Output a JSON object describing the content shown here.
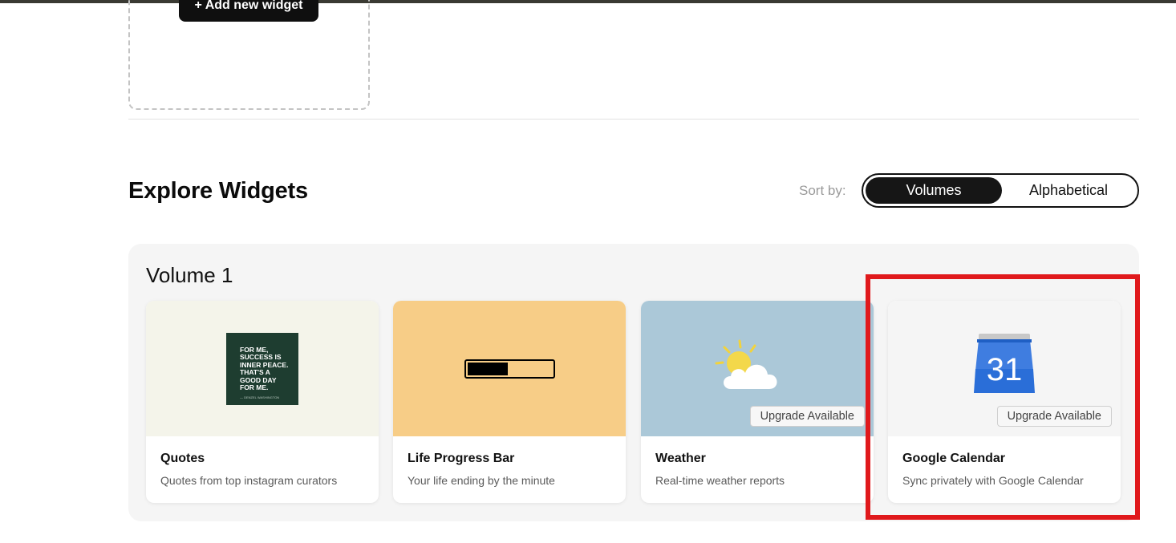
{
  "add_widget": {
    "label": "+ Add new widget"
  },
  "explore": {
    "title": "Explore Widgets",
    "sort_label": "Sort by:",
    "sort_options": {
      "active": "Volumes",
      "inactive": "Alphabetical"
    }
  },
  "volume": {
    "title": "Volume 1",
    "cards": [
      {
        "name": "Quotes",
        "description": "Quotes from top instagram curators",
        "thumb_bg": "#f4f4ea",
        "quote_lines": [
          "For me,",
          "success is",
          "inner peace.",
          "That's a",
          "good day",
          "for me."
        ],
        "quote_author": "— Denzel Washington"
      },
      {
        "name": "Life Progress Bar",
        "description": "Your life ending by the minute",
        "thumb_bg": "#f7cd87",
        "progress": 0.48
      },
      {
        "name": "Weather",
        "description": "Real-time weather reports",
        "thumb_bg": "#abc8d8",
        "badge": "Upgrade Available"
      },
      {
        "name": "Google Calendar",
        "description": "Sync privately with Google Calendar",
        "thumb_bg": "#f5f5f5",
        "badge": "Upgrade Available",
        "calendar_day": "31"
      }
    ]
  },
  "colors": {
    "accent": "#161616",
    "highlight": "#e0191c",
    "panel": "#f5f5f5"
  }
}
